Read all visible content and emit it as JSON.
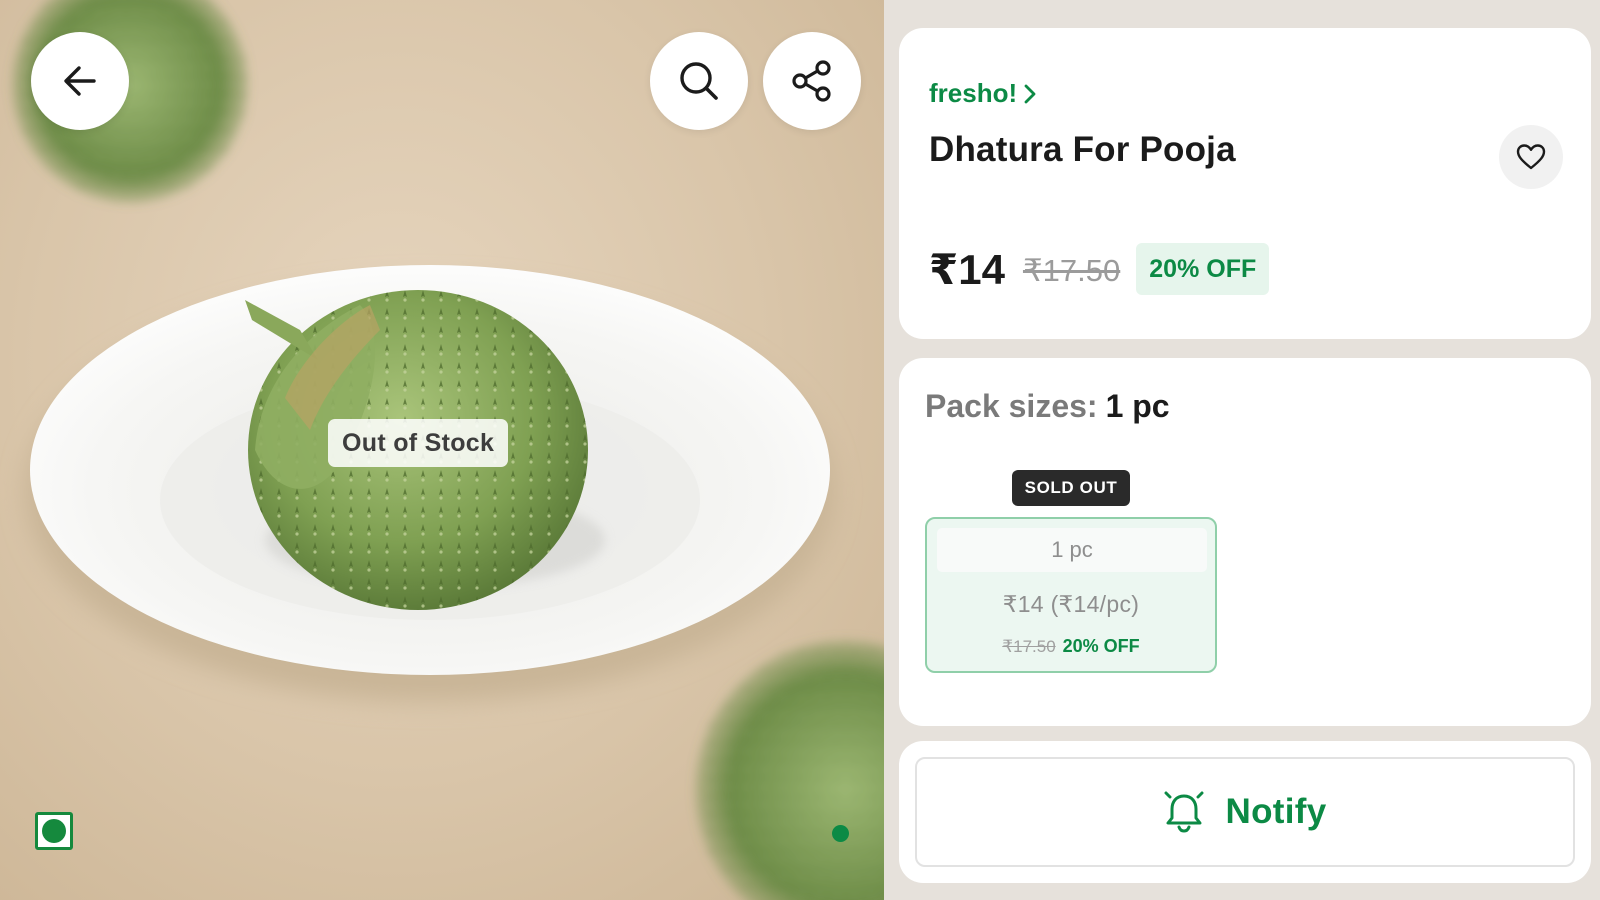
{
  "image": {
    "out_of_stock_label": "Out of Stock",
    "veg_indicator": "veg-mark",
    "carousel_pages": 1
  },
  "actions": {
    "back_icon": "arrow-left-icon",
    "search_icon": "search-icon",
    "share_icon": "share-icon",
    "favorite_icon": "heart-icon"
  },
  "product": {
    "brand": "fresho!",
    "title": "Dhatura For Pooja",
    "price": "₹14",
    "mrp": "₹17.50",
    "discount": "20% OFF"
  },
  "pack": {
    "label": "Pack sizes:",
    "selected": "1 pc",
    "sold_out_badge": "SOLD OUT",
    "options": [
      {
        "size": "1 pc",
        "price_line": "₹14 (₹14/pc)",
        "mrp": "₹17.50",
        "discount": "20% OFF"
      }
    ]
  },
  "notify": {
    "label": "Notify",
    "icon": "bell-icon"
  },
  "colors": {
    "brand_green": "#0c8a45",
    "badge_bg": "#e6f5ec",
    "sold_out_bg": "#2a2a2a"
  }
}
